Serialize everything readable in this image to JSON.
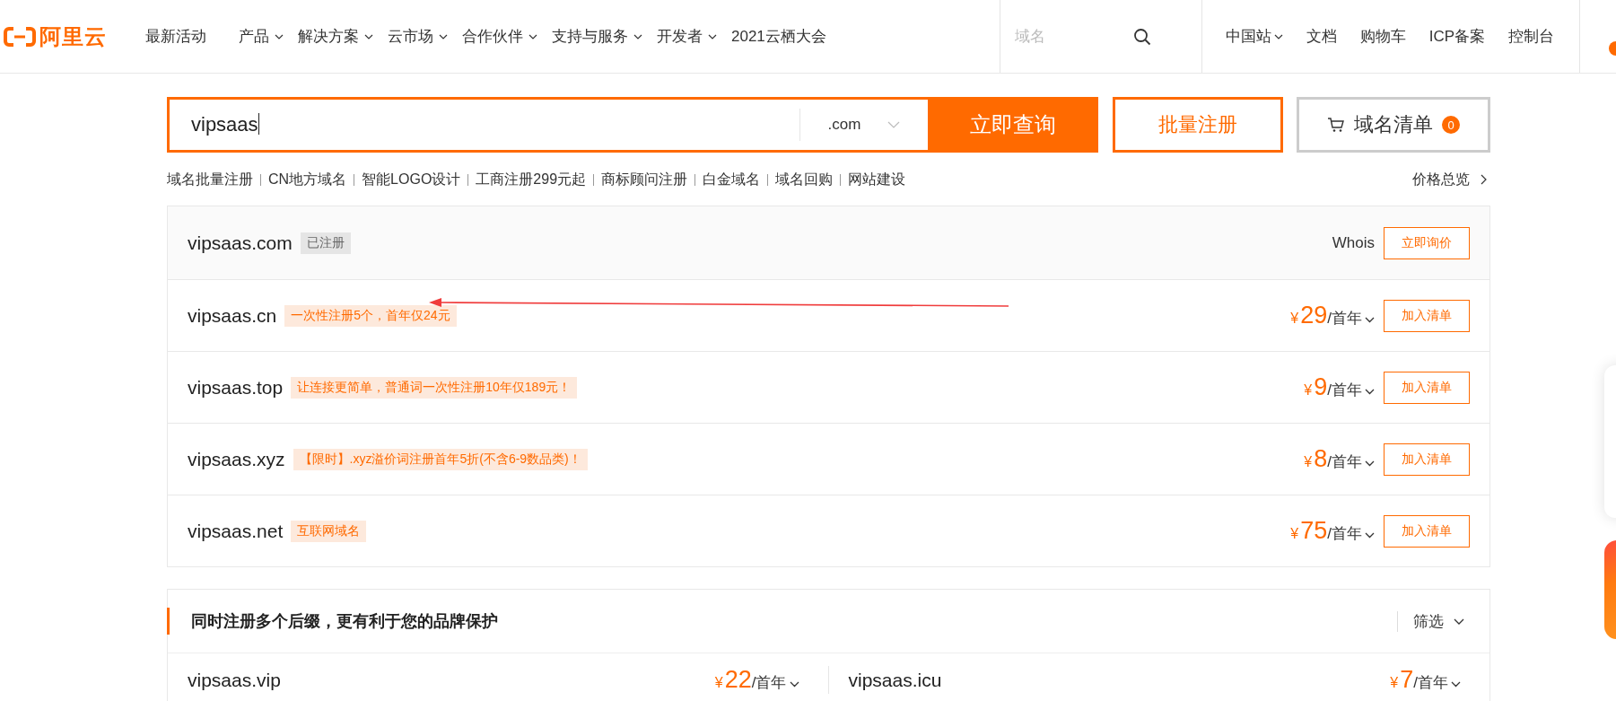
{
  "logo": {
    "text": "阿里云"
  },
  "nav": [
    {
      "label": "最新活动",
      "dropdown": false
    },
    {
      "label": "产品",
      "dropdown": true
    },
    {
      "label": "解决方案",
      "dropdown": true
    },
    {
      "label": "云市场",
      "dropdown": true
    },
    {
      "label": "合作伙伴",
      "dropdown": true
    },
    {
      "label": "支持与服务",
      "dropdown": true
    },
    {
      "label": "开发者",
      "dropdown": true
    },
    {
      "label": "2021云栖大会",
      "dropdown": false
    }
  ],
  "top_search": {
    "placeholder": "域名"
  },
  "top_links": [
    {
      "label": "中国站",
      "dropdown": true
    },
    {
      "label": "文档",
      "dropdown": false
    },
    {
      "label": "购物车",
      "dropdown": false
    },
    {
      "label": "ICP备案",
      "dropdown": false
    },
    {
      "label": "控制台",
      "dropdown": false
    }
  ],
  "search": {
    "value": "vipsaas",
    "suffix": ".com",
    "button": "立即查询"
  },
  "bulk_button": "批量注册",
  "cart_button": {
    "label": "域名清单",
    "count": "0"
  },
  "quick_links": [
    "域名批量注册",
    "CN地方域名",
    "智能LOGO设计",
    "工商注册299元起",
    "商标顾问注册",
    "白金域名",
    "域名回购",
    "网站建设"
  ],
  "price_overview": "价格总览",
  "results": [
    {
      "kind": "registered",
      "domain": "vipsaas.com",
      "tag": "已注册",
      "whois": "Whois",
      "action": "立即询价"
    },
    {
      "kind": "available",
      "domain": "vipsaas.cn",
      "tag": "一次性注册5个，首年仅24元",
      "currency": "¥",
      "amount": "29",
      "unit": "/首年",
      "action": "加入清单"
    },
    {
      "kind": "available",
      "domain": "vipsaas.top",
      "tag": "让连接更简单，普通词一次性注册10年仅189元！",
      "currency": "¥",
      "amount": "9",
      "unit": "/首年",
      "action": "加入清单"
    },
    {
      "kind": "available",
      "domain": "vipsaas.xyz",
      "tag": "【限时】.xyz溢价词注册首年5折(不含6-9数品类)！",
      "currency": "¥",
      "amount": "8",
      "unit": "/首年",
      "action": "加入清单"
    },
    {
      "kind": "available",
      "domain": "vipsaas.net",
      "tag": "互联网域名",
      "currency": "¥",
      "amount": "75",
      "unit": "/首年",
      "action": "加入清单"
    }
  ],
  "suggestions": {
    "title": "同时注册多个后缀，更有利于您的品牌保护",
    "filter": "筛选",
    "items": [
      {
        "domain": "vipsaas.vip",
        "currency": "¥",
        "amount": "22",
        "unit": "/首年"
      },
      {
        "domain": "vipsaas.icu",
        "currency": "¥",
        "amount": "7",
        "unit": "/首年"
      }
    ]
  }
}
